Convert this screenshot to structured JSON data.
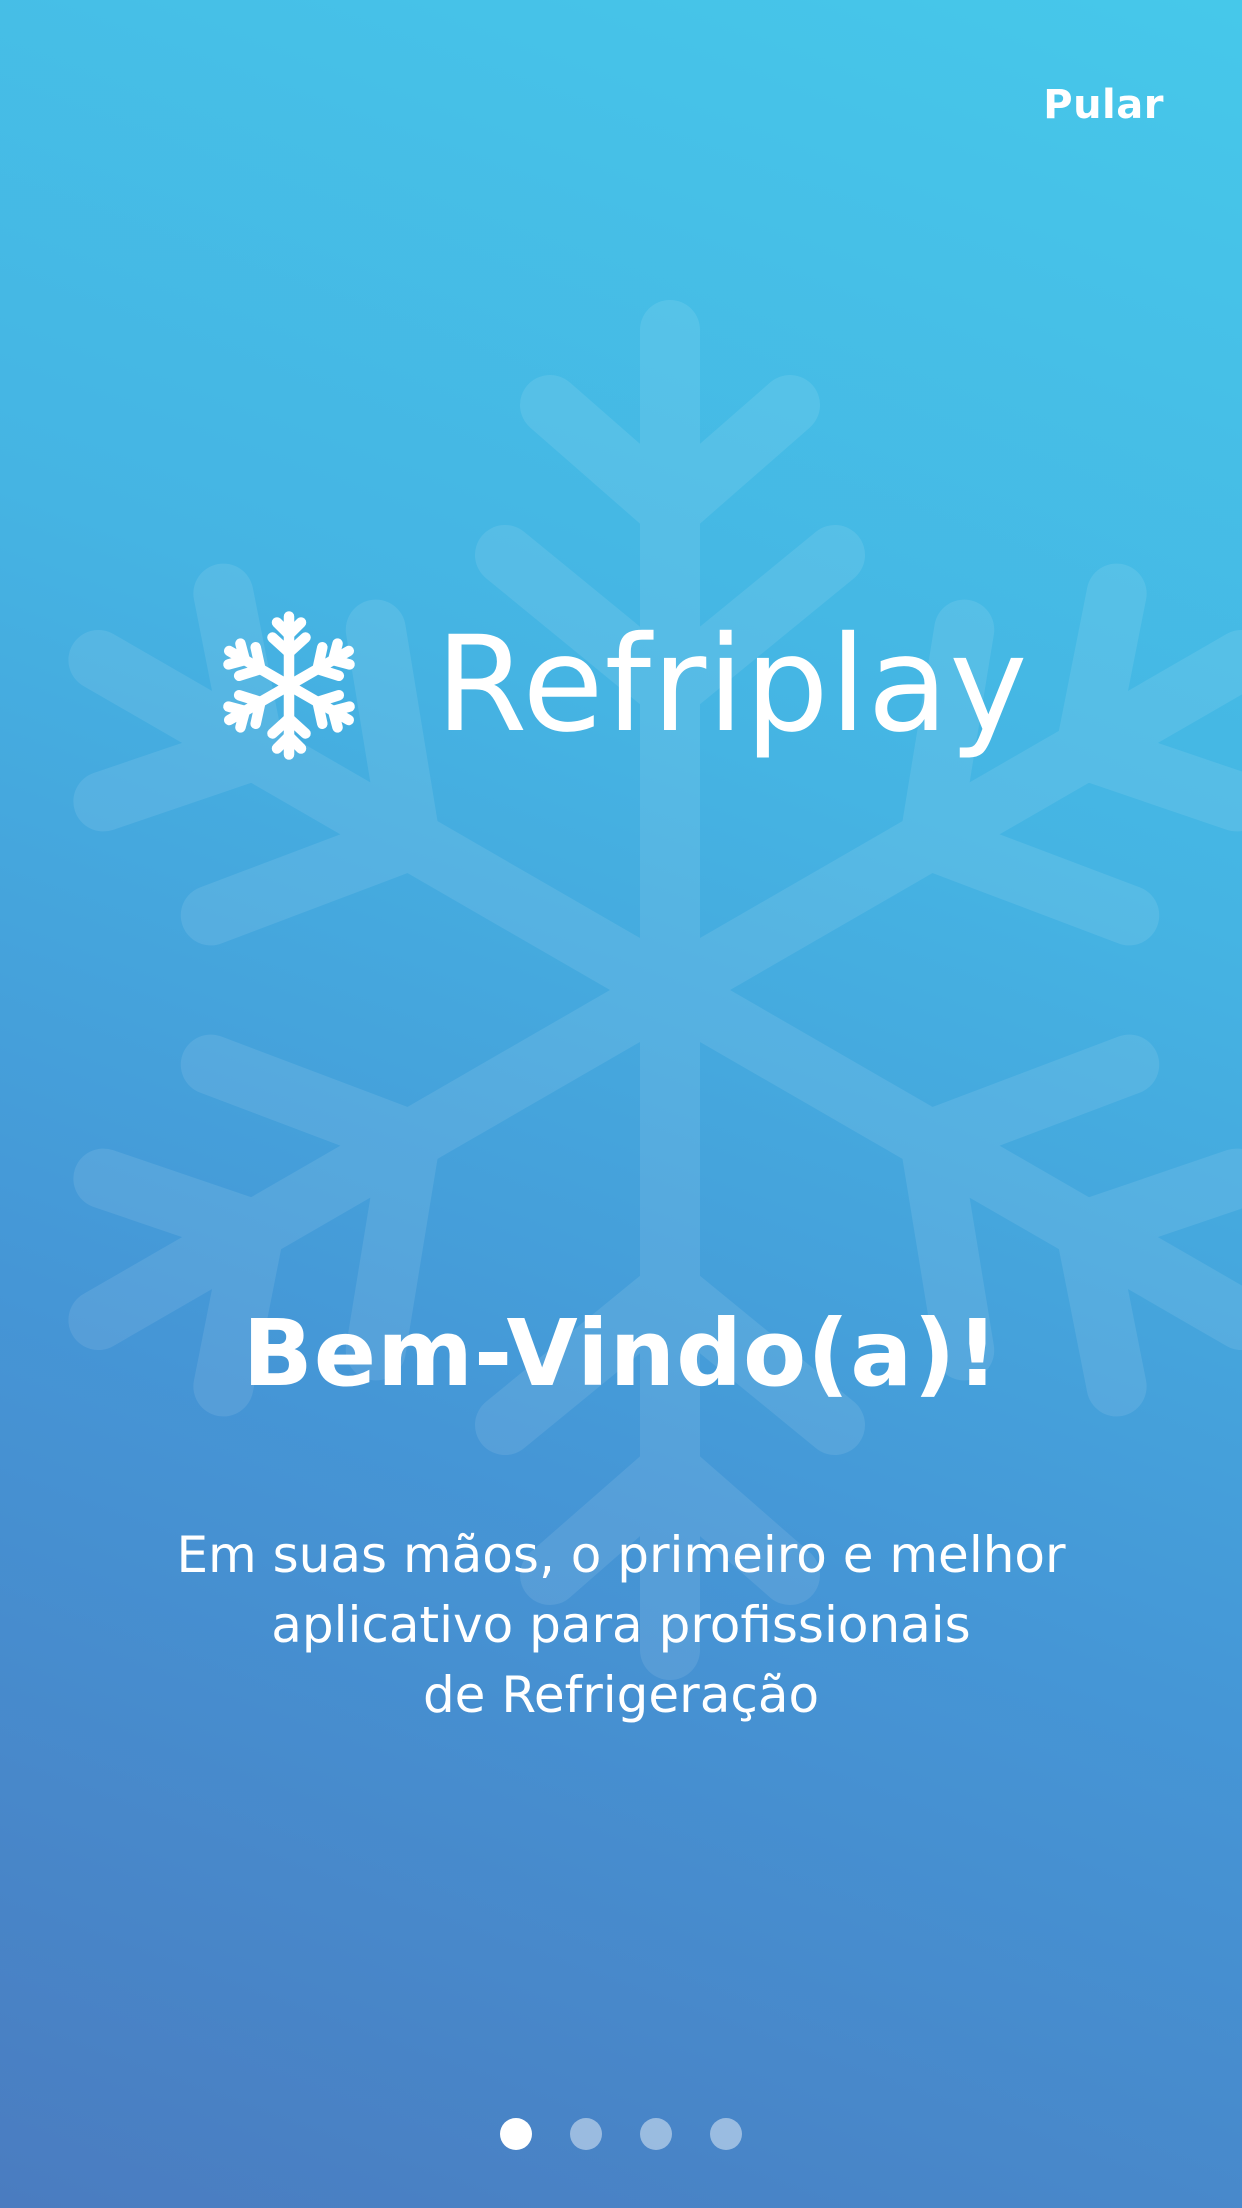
{
  "header": {
    "skip_label": "Pular"
  },
  "logo": {
    "icon": "snowflake-icon",
    "text": "Refriplay"
  },
  "welcome": {
    "title": "Bem-Vindo(a)!",
    "lines": [
      "Em suas mãos, o primeiro e melhor",
      "aplicativo para profissionais",
      "de Refrigeração"
    ]
  },
  "pagination": {
    "total": 4,
    "active_index": 0
  },
  "colors": {
    "gradient_top": "#46c8ea",
    "gradient_bottom": "#4a7cc0",
    "text": "#ffffff"
  }
}
